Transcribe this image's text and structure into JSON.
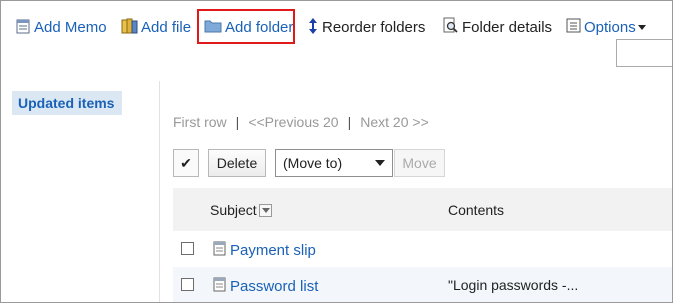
{
  "toolbar": {
    "add_memo": "Add Memo",
    "add_file": "Add file",
    "add_folder": "Add folder",
    "reorder_folders": "Reorder folders",
    "folder_details": "Folder details",
    "options": "Options",
    "highlight_color": "#e0191b"
  },
  "sidebar": {
    "items": [
      {
        "label": "Updated items"
      }
    ]
  },
  "pager": {
    "first_row": "First row",
    "separator": "|",
    "previous": "<<Previous 20",
    "next": "Next 20 >>"
  },
  "actions": {
    "check_all": "✔",
    "delete_label": "Delete",
    "move_to_select": "(Move to)",
    "move_label": "Move"
  },
  "table": {
    "columns": [
      "Subject",
      "Contents"
    ],
    "rows": [
      {
        "subject": "Payment slip",
        "contents": ""
      },
      {
        "subject": "Password list",
        "contents": "\"Login passwords -..."
      }
    ]
  },
  "icons": {
    "memo": "memo-icon",
    "file": "file-icon",
    "folder": "folder-icon",
    "reorder": "up-down-arrows-icon",
    "details": "magnifier-document-icon",
    "options": "list-icon"
  },
  "colors": {
    "link": "#1a61b7",
    "sidebar_selected_bg": "#dbe8f3",
    "header_bg": "#f2f2f2"
  }
}
